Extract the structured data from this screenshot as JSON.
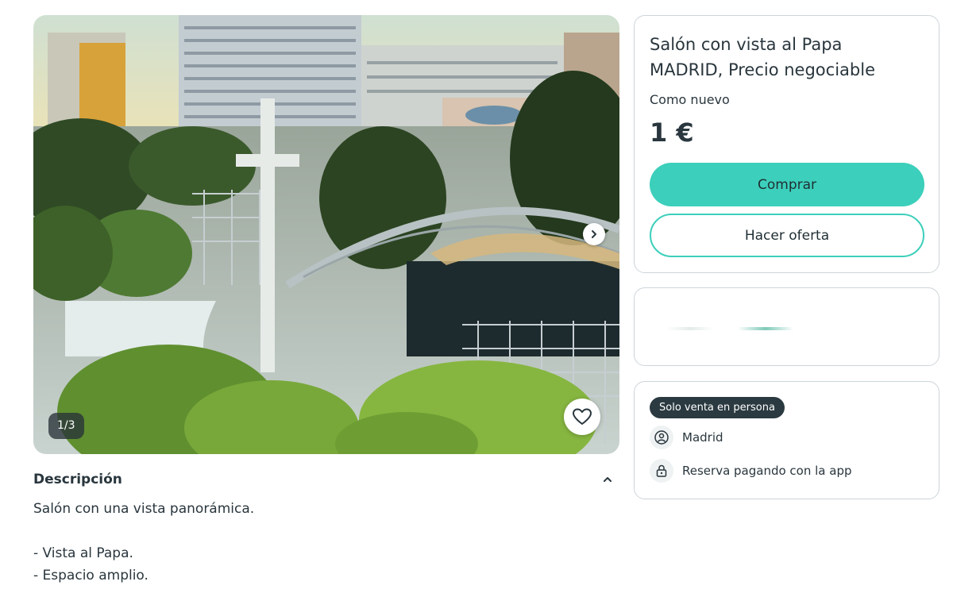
{
  "gallery": {
    "counter": "1/3",
    "next_icon": "chevron-right-icon",
    "favorite_icon": "heart-outline-icon"
  },
  "product": {
    "title": "Salón con vista al Papa MADRID, Precio negociable",
    "condition": "Como nuevo",
    "price": "1 €"
  },
  "actions": {
    "buy_label": "Comprar",
    "offer_label": "Hacer oferta"
  },
  "delivery": {
    "badge": "Solo venta en persona",
    "location": "Madrid",
    "location_icon": "location-pin-icon",
    "reserve": "Reserva pagando con la app",
    "reserve_icon": "lock-icon"
  },
  "description": {
    "title": "Descripción",
    "collapse_icon": "chevron-up-icon",
    "text": "Salón con una vista panorámica.\n\n- Vista al Papa.\n- Espacio amplio."
  },
  "colors": {
    "accent": "#3ccfbb",
    "text": "#29363d",
    "border": "#cdd5d9",
    "badge_bg": "#2b3a40"
  }
}
